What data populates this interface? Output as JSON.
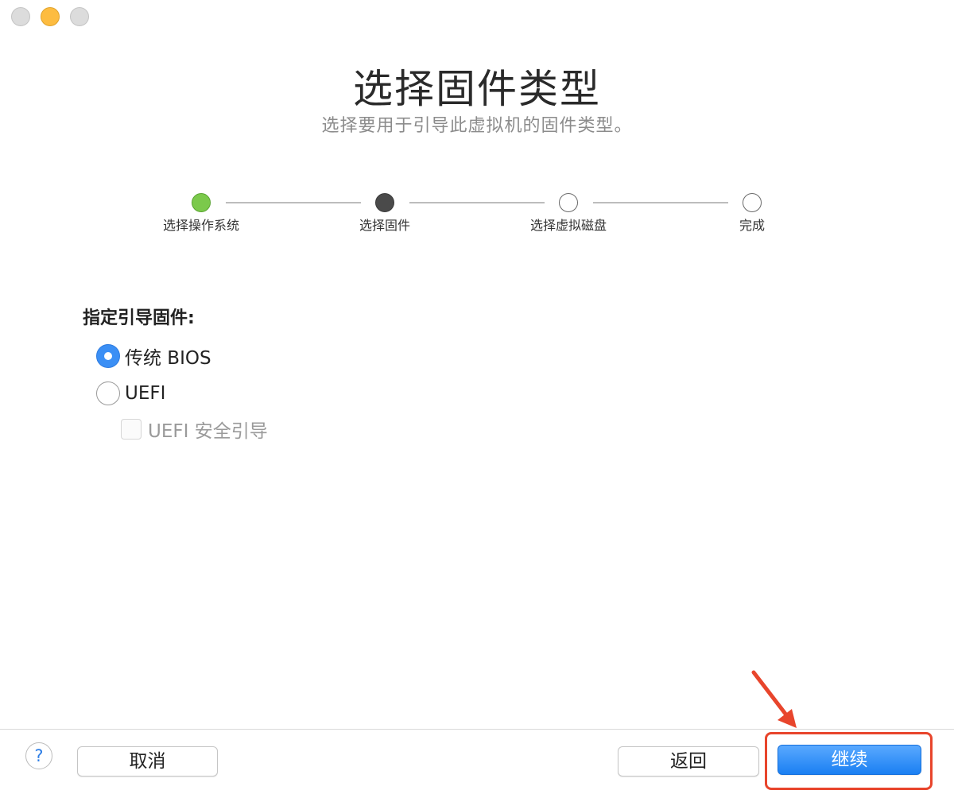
{
  "window": {
    "controls": [
      "close",
      "minimize",
      "zoom"
    ]
  },
  "header": {
    "title": "选择固件类型",
    "subtitle": "选择要用于引导此虚拟机的固件类型。"
  },
  "steps": [
    {
      "label": "选择操作系统",
      "state": "done"
    },
    {
      "label": "选择固件",
      "state": "current"
    },
    {
      "label": "选择虚拟磁盘",
      "state": "pending"
    },
    {
      "label": "完成",
      "state": "pending"
    }
  ],
  "form": {
    "section_label": "指定引导固件:",
    "options": [
      {
        "label": "传统 BIOS",
        "selected": true
      },
      {
        "label": "UEFI",
        "selected": false
      }
    ],
    "secure_boot": {
      "label": "UEFI 安全引导",
      "checked": false,
      "enabled": false
    }
  },
  "footer": {
    "help_label": "?",
    "cancel_label": "取消",
    "back_label": "返回",
    "continue_label": "继续"
  },
  "colors": {
    "accent": "#1a7ff2",
    "step_done": "#7bc94b",
    "annotation": "#e8452c"
  }
}
